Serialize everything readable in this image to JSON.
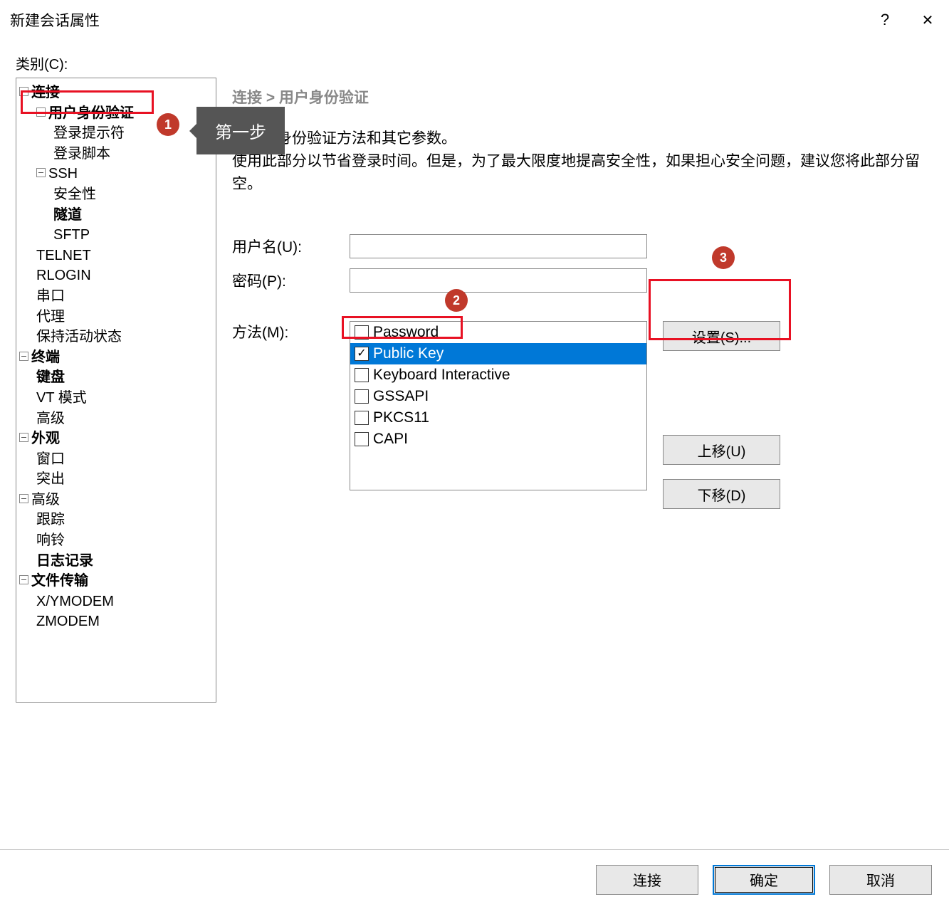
{
  "titlebar": {
    "title": "新建会话属性",
    "help": "?",
    "close": "✕"
  },
  "category_label": "类别(C):",
  "tree": {
    "n_connection": "连接",
    "n_auth": "用户身份验证",
    "n_prompt": "登录提示符",
    "n_script": "登录脚本",
    "n_ssh": "SSH",
    "n_security": "安全性",
    "n_tunnel": "隧道",
    "n_sftp": "SFTP",
    "n_telnet": "TELNET",
    "n_rlogin": "RLOGIN",
    "n_serial": "串口",
    "n_proxy": "代理",
    "n_keepalive": "保持活动状态",
    "n_terminal": "终端",
    "n_keyboard": "键盘",
    "n_vt": "VT 模式",
    "n_advanced1": "高级",
    "n_appearance": "外观",
    "n_window": "窗口",
    "n_highlight": "突出",
    "n_advanced": "高级",
    "n_trace": "跟踪",
    "n_bell": "响铃",
    "n_logging": "日志记录",
    "n_filetransfer": "文件传输",
    "n_xymodem": "X/YMODEM",
    "n_zmodem": "ZMODEM"
  },
  "breadcrumb": "连接 > 用户身份验证",
  "description": "请选择身份验证方法和其它参数。\n使用此部分以节省登录时间。但是，为了最大限度地提高安全性，如果担心安全问题，建议您将此部分留空。",
  "form": {
    "username_label": "用户名(U):",
    "username_value": "",
    "password_label": "密码(P):",
    "password_value": "",
    "method_label": "方法(M):"
  },
  "methods": [
    {
      "label": "Password",
      "checked": false,
      "selected": false
    },
    {
      "label": "Public Key",
      "checked": true,
      "selected": true
    },
    {
      "label": "Keyboard Interactive",
      "checked": false,
      "selected": false
    },
    {
      "label": "GSSAPI",
      "checked": false,
      "selected": false
    },
    {
      "label": "PKCS11",
      "checked": false,
      "selected": false
    },
    {
      "label": "CAPI",
      "checked": false,
      "selected": false
    }
  ],
  "buttons": {
    "settings": "设置(S)...",
    "moveup": "上移(U)",
    "movedown": "下移(D)",
    "connect": "连接",
    "ok": "确定",
    "cancel": "取消"
  },
  "annotations": {
    "badge1": "1",
    "label1": "第一步",
    "badge2": "2",
    "badge3": "3"
  }
}
